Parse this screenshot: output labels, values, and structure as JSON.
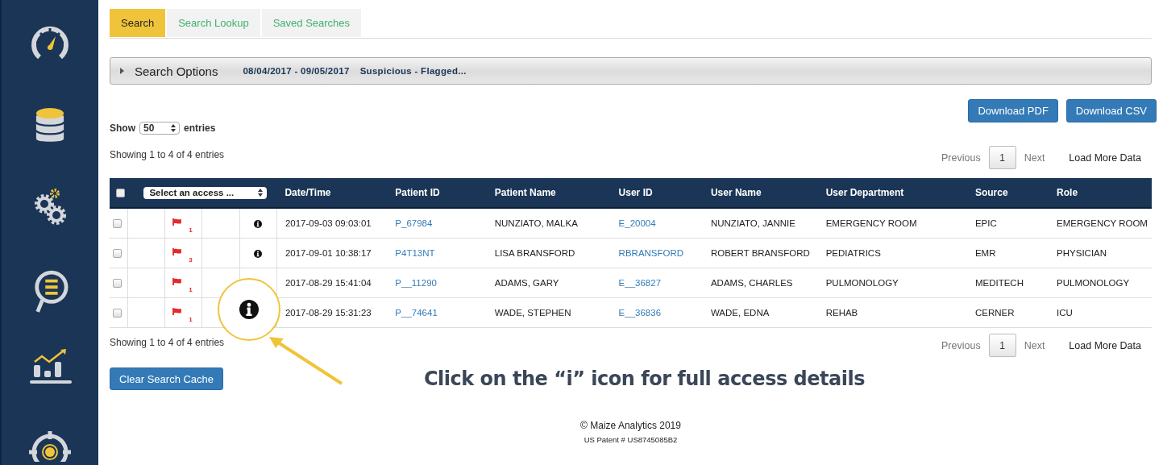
{
  "tabs": [
    {
      "label": "Search",
      "selected": true
    },
    {
      "label": "Search Lookup",
      "selected": false
    },
    {
      "label": "Saved Searches",
      "selected": false
    }
  ],
  "search_options": {
    "label": "Search Options",
    "date_range": "08/04/2017 - 09/05/2017",
    "filter": "Suspicious - Flagged..."
  },
  "buttons": [
    "Download PDF",
    "Download CSV"
  ],
  "length_menu": {
    "before": "Show",
    "value": "50",
    "after": "entries"
  },
  "info_top": "Showing 1 to 4 of 4 entries",
  "pagination_top": {
    "previous": "Previous",
    "page": "1",
    "next": "Next",
    "load_more": "Load More Data"
  },
  "table": {
    "select_all_checked": false,
    "access_select": "Select an access ...",
    "columns": [
      "Date/Time",
      "Patient ID",
      "Patient Name",
      "User ID",
      "User Name",
      "User Department",
      "Source",
      "Role"
    ],
    "rows": [
      {
        "checked": false,
        "flag_count": "1",
        "cells": [
          "2017-09-03 09:03:01",
          "P_67984",
          "NUNZIATO, MALKA",
          "E_20004",
          "NUNZIATO, JANNIE",
          "EMERGENCY ROOM",
          "EPIC",
          "EMERGENCY ROOM"
        ]
      },
      {
        "checked": false,
        "flag_count": "3",
        "cells": [
          "2017-09-01 10:38:17",
          "P4T13NT",
          "LISA BRANSFORD",
          "RBRANSFORD",
          "ROBERT BRANSFORD",
          "PEDIATRICS",
          "EMR",
          "PHYSICIAN"
        ]
      },
      {
        "checked": false,
        "flag_count": "1",
        "cells": [
          "2017-08-29 15:41:04",
          "P__11290",
          "ADAMS, GARY",
          "E__36827",
          "ADAMS, CHARLES",
          "PULMONOLOGY",
          "MEDITECH",
          "PULMONOLOGY"
        ]
      },
      {
        "checked": false,
        "flag_count": "1",
        "cells": [
          "2017-08-29 15:31:23",
          "P__74641",
          "WADE, STEPHEN",
          "E__36836",
          "WADE, EDNA",
          "REHAB",
          "CERNER",
          "ICU"
        ]
      }
    ]
  },
  "info_bottom": "Showing 1 to 4 of 4 entries",
  "pagination_bottom": {
    "previous": "Previous",
    "page": "1",
    "next": "Next",
    "load_more": "Load More Data"
  },
  "clear_button": "Clear Search Cache",
  "callout": "Click on the “i” icon for full access details",
  "footer": {
    "copyright": "© Maize Analytics 2019",
    "patent": "US Patent # US8745085B2"
  }
}
